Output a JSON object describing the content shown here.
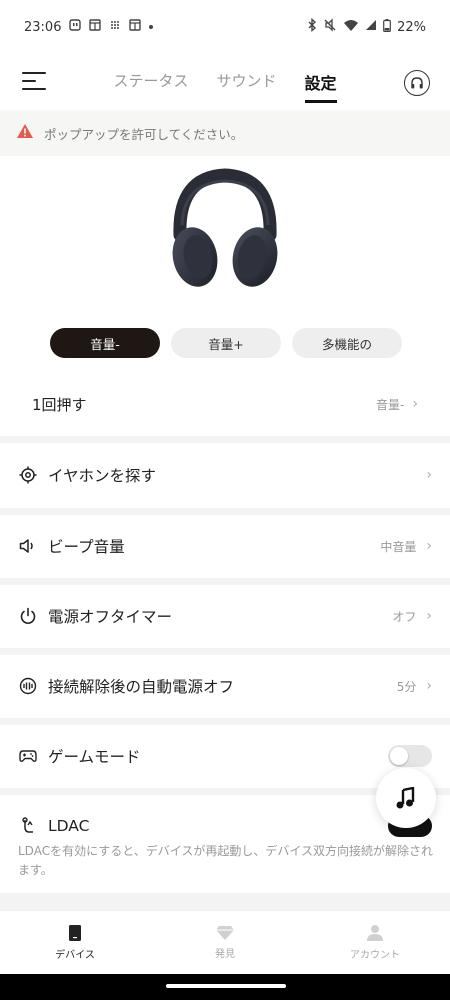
{
  "status_bar": {
    "time": "23:06",
    "battery": "22%"
  },
  "header": {
    "tabs": [
      {
        "label": "ステータス",
        "active": false
      },
      {
        "label": "サウンド",
        "active": false
      },
      {
        "label": "設定",
        "active": true
      }
    ]
  },
  "banner": {
    "text": "ポップアップを許可してください。",
    "icon": "warning-icon",
    "color": "#e25b4f"
  },
  "controls": {
    "buttons": [
      {
        "label": "音量-",
        "active": true
      },
      {
        "label": "音量+",
        "active": false
      },
      {
        "label": "多機能の",
        "active": false
      }
    ],
    "press_label": "1回押す",
    "press_value": "音量-"
  },
  "settings": [
    {
      "label": "イヤホンを探す",
      "value": "",
      "icon": "target-icon"
    },
    {
      "label": "ビープ音量",
      "value": "中音量",
      "icon": "speaker-icon"
    },
    {
      "label": "電源オフタイマー",
      "value": "オフ",
      "icon": "power-icon"
    },
    {
      "label": "接続解除後の自動電源オフ",
      "value": "5分",
      "icon": "auto-off-icon"
    },
    {
      "label": "ゲームモード",
      "toggle": false,
      "icon": "gamepad-icon"
    },
    {
      "label": "LDAC",
      "icon": "ldac-icon"
    }
  ],
  "ldac_description": "LDACを有効にすると、デバイスが再起動し、デバイス双方向接続が解除されます。",
  "bottom_nav": [
    {
      "label": "デバイス",
      "active": true,
      "icon": "device-icon"
    },
    {
      "label": "発見",
      "active": false,
      "icon": "discover-icon"
    },
    {
      "label": "アカウント",
      "active": false,
      "icon": "account-icon"
    }
  ],
  "colors": {
    "accent": "#1e1714",
    "inactive": "#999999"
  }
}
